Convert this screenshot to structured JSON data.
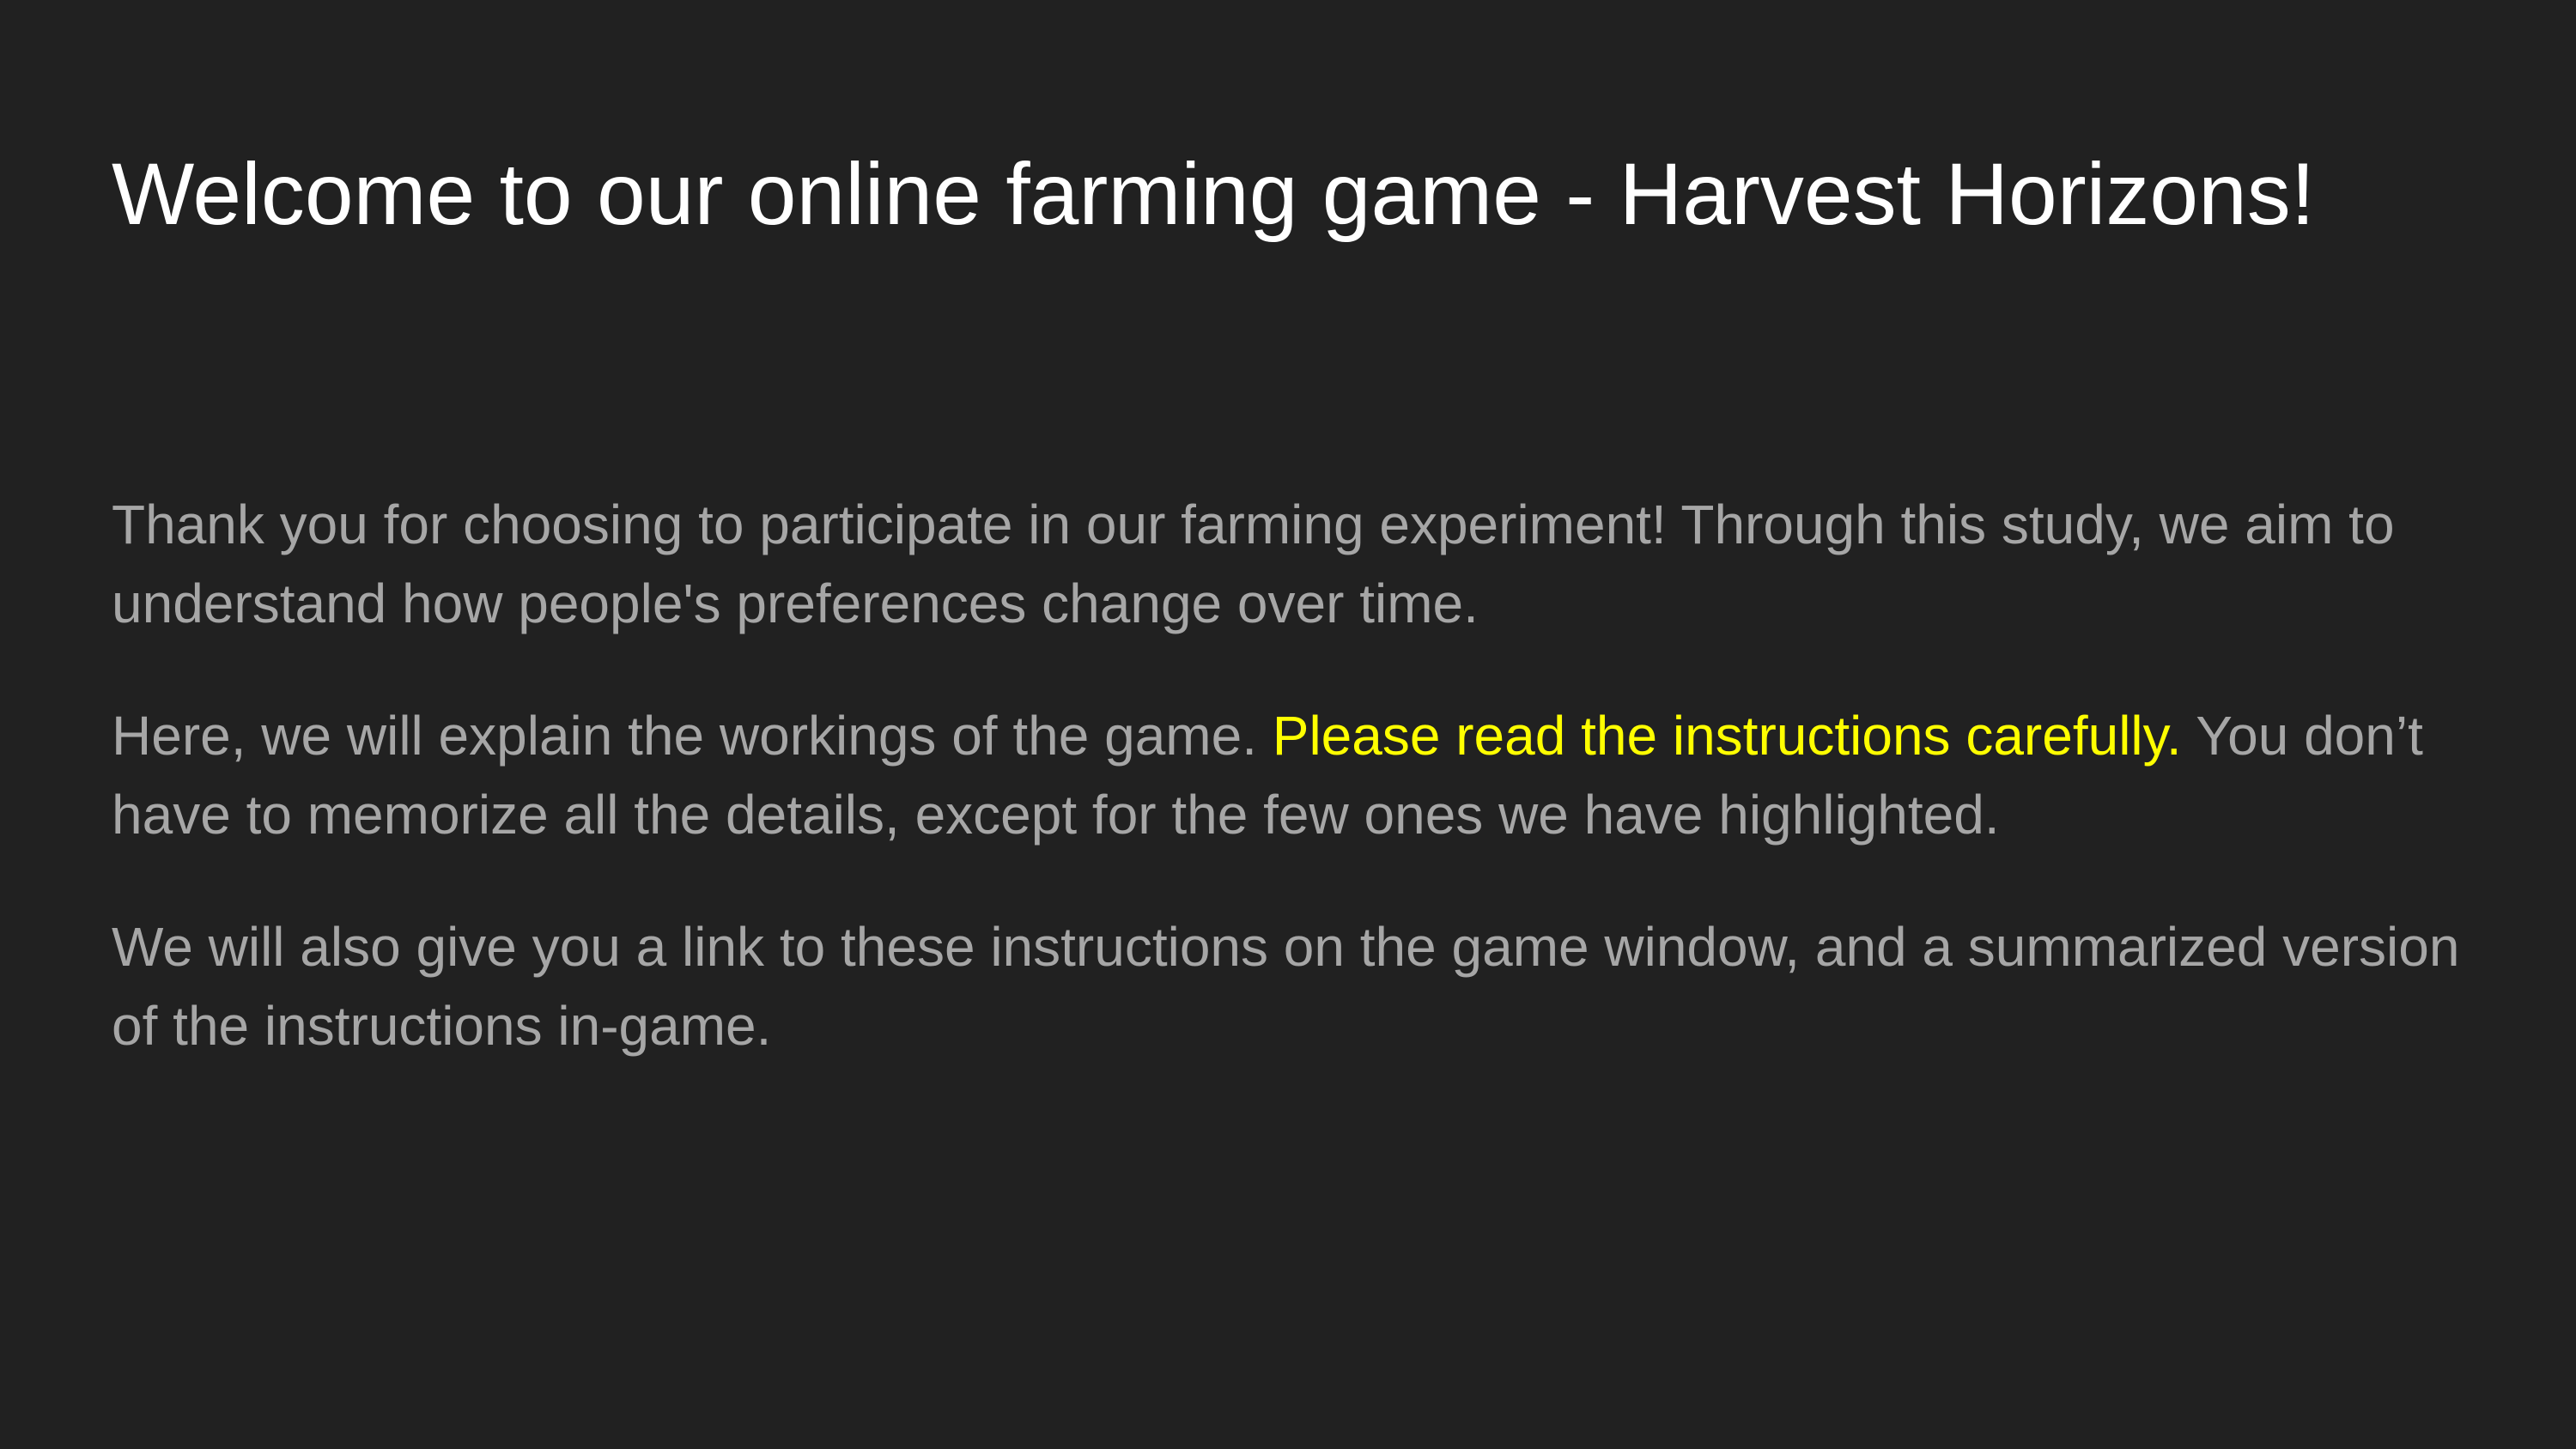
{
  "title": "Welcome to our online farming game - Harvest Horizons!",
  "paragraphs": {
    "p1": "Thank you for choosing to participate in our farming experiment! Through this study, we aim to understand how people's preferences change over time.",
    "p2_before": "Here, we will explain the workings of the game. ",
    "p2_highlight": "Please read the instructions carefully.",
    "p2_after": " You don’t have to memorize all the details, except for the few ones we have highlighted.",
    "p3": "We will also give you a link to these instructions on the game window, and a summarized version of the instructions in-game."
  },
  "colors": {
    "background": "#212121",
    "title": "#ffffff",
    "body_text": "#a6a6a6",
    "highlight": "#ffff00"
  }
}
